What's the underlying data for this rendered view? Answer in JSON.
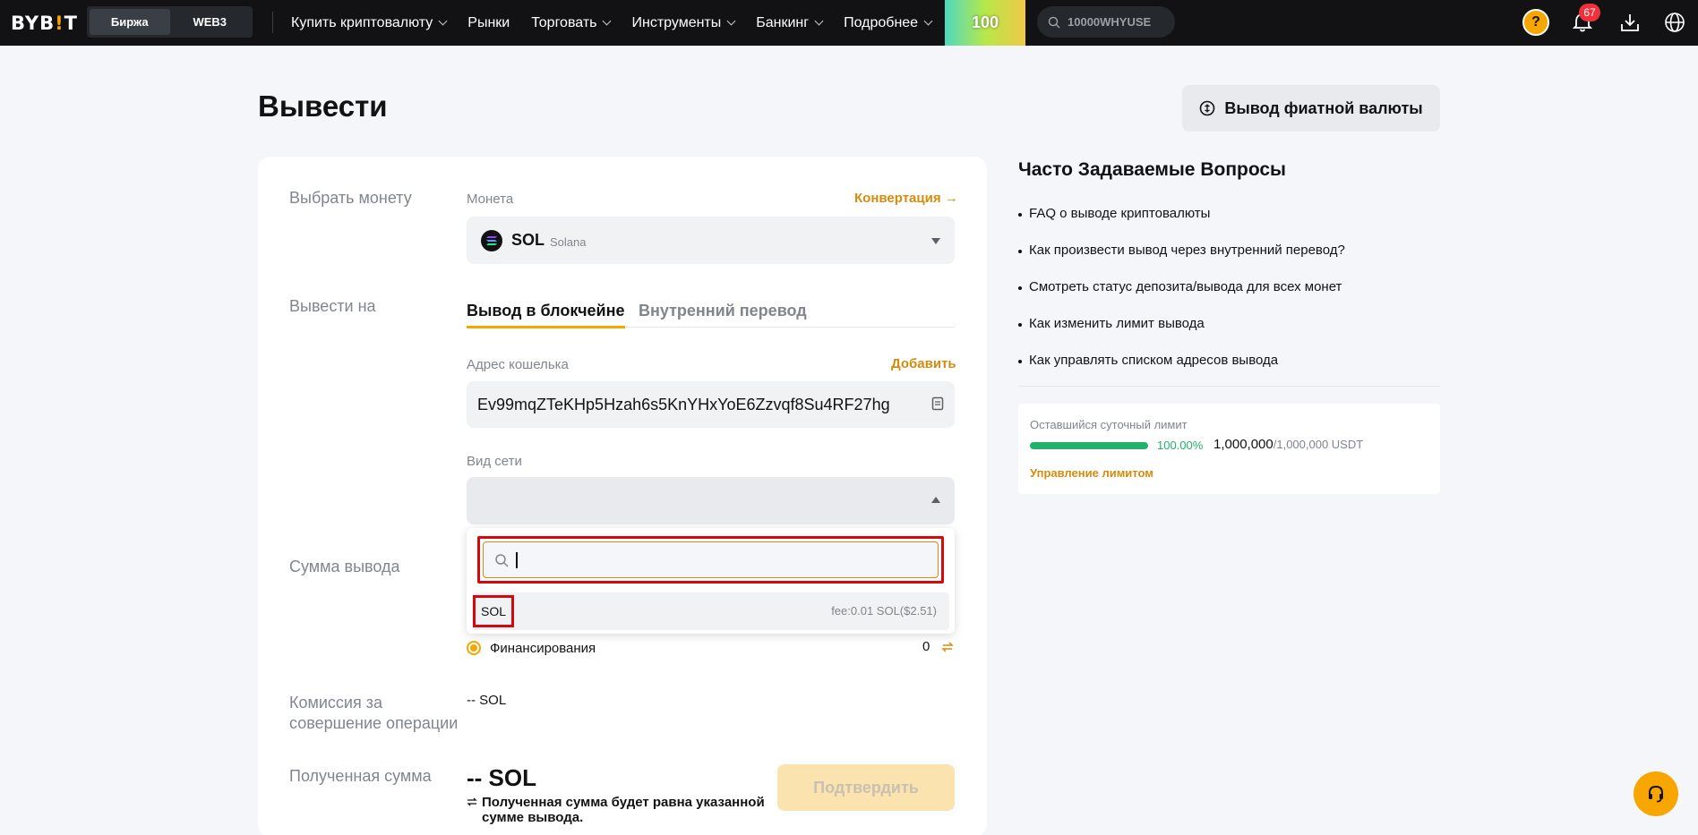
{
  "nav": {
    "logo_main": "BYB",
    "logo_tick": "!",
    "logo_end": "T",
    "switch": [
      "Биржа",
      "WEB3"
    ],
    "items": [
      "Купить криптовалюту",
      "Рынки",
      "Торговать",
      "Инструменты",
      "Банкинг",
      "Подробнее"
    ],
    "promo": "100",
    "search_placeholder": "10000WHYUSE",
    "avatar_glyph": "?",
    "notifications": "67"
  },
  "page": {
    "title": "Вывести",
    "fiat_button": "Вывод фиатной валюты"
  },
  "form": {
    "coin_label": "Выбрать монету",
    "coin_sub": "Монета",
    "convert_link": "Конвертация",
    "coin_symbol": "SOL",
    "coin_name": "Solana",
    "withdraw_to_label": "Вывести на",
    "tabs": [
      "Вывод в блокчейне",
      "Внутренний перевод"
    ],
    "wallet_label": "Адрес кошелька",
    "add_link": "Добавить",
    "wallet_value": "Ev99mqZTeKHp5Hzah6s5KnYHxYoE6Zzvqf8Su4RF27hg",
    "network_label": "Вид сети",
    "network_options": [
      {
        "symbol": "SOL",
        "fee": "fee:0.01  SOL($2.51)"
      }
    ],
    "amount_label": "Сумма вывода",
    "funding_label": "Финансирования",
    "funding_value": "0",
    "commission_label": "Комиссия за совершение операции",
    "commission_value": "-- SOL",
    "received_label": "Полученная сумма",
    "received_value": "-- SOL",
    "received_note": "Полученная сумма будет равна указанной сумме вывода.",
    "confirm_button": "Подтвердить"
  },
  "faq": {
    "title": "Часто Задаваемые Вопросы",
    "items": [
      "FAQ о выводе криптовалюты",
      "Как произвести вывод через внутренний перевод?",
      "Смотреть статус депозита/вывода для всех монет",
      "Как изменить лимит вывода",
      "Как управлять списком адресов вывода"
    ]
  },
  "limit": {
    "label": "Оставшийся суточный лимит",
    "percent": "100.00%",
    "remaining": "1,000,000",
    "max": "/1,000,000 USDT",
    "manage_link": "Управление лимитом"
  },
  "colors": {
    "accent": "#f7a600",
    "link": "#d58b0d",
    "success": "#20b26c",
    "highlight": "#d4080f"
  }
}
